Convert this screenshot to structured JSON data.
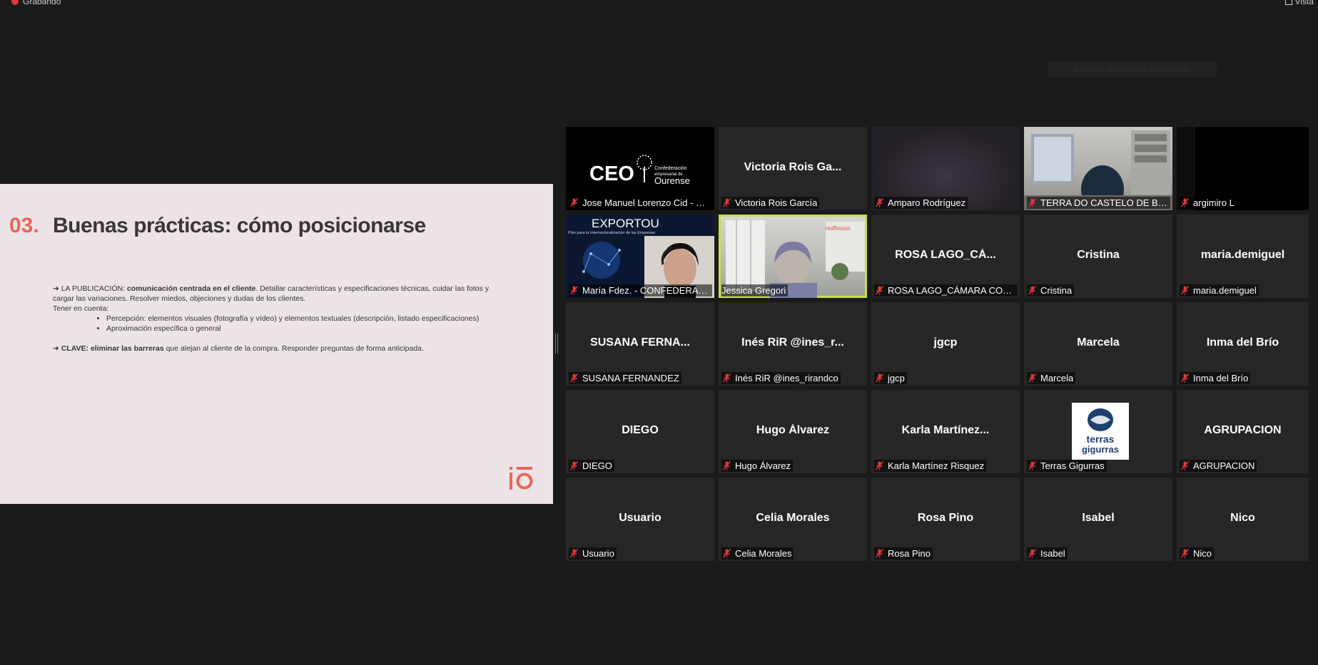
{
  "topbar": {
    "recording_label": "Grabando",
    "view_label": "Vista"
  },
  "banner": {
    "text": "Detener la pantalla compartida"
  },
  "slide": {
    "number": "03.",
    "title": "Buenas prácticas: cómo posicionarse",
    "p1_prefix": "➜ LA PUBLICACIÓN: ",
    "p1_bold": "comunicación centrada en el cliente",
    "p1_rest": ". Detallar características y especificaciones técnicas, cuidar las fotos y cargar las variaciones. Resolver miedos, objeciones y dudas de los clientes.",
    "p2": "Tener en cuenta:",
    "bullets": [
      "Percepción: elementos visuales (fotografía y vídeo) y elementos textuales (descripción, listado especificaciones)",
      "Aproximación específica o general"
    ],
    "p3_prefix": "➜ ",
    "p3_bold": "CLAVE: eliminar las barreras",
    "p3_rest": " que alejan al cliente de la compra. Responder preguntas de forma anticipada.",
    "logo_text": "io"
  },
  "accent_colors": {
    "slide_accent": "#e8655a",
    "active_speaker": "#c7e046",
    "mic_muted": "#e0393e"
  },
  "participants": [
    {
      "label": "Jose Manuel Lorenzo Cid - C...",
      "display": "",
      "video": "ceo-logo",
      "logo_text": "CEO",
      "logo_sub": "Confederación empresarial de Ourense"
    },
    {
      "label": "Victoria Rois García",
      "display": "Victoria Rois Ga..."
    },
    {
      "label": "Amparo Rodríguez",
      "display": "",
      "video": "dark-room"
    },
    {
      "label": "TERRA DO CASTELO DE BEADE",
      "display": "",
      "video": "office"
    },
    {
      "label": "argimiro L",
      "display": "",
      "video": "black"
    },
    {
      "label": "María Fdez. - CONFEDERACI...",
      "display": "",
      "video": "exportou",
      "logo_text": "EXPORTOU",
      "logo_sub": "Plan para la Internacionalización de las Empresas"
    },
    {
      "label": "Jessica Gregori",
      "display": "",
      "video": "person",
      "active": true,
      "logo_text": "redflexión"
    },
    {
      "label": "ROSA LAGO_CÁMARA COME...",
      "display": "ROSA LAGO_CÁ..."
    },
    {
      "label": "Cristina",
      "display": "Cristina"
    },
    {
      "label": "maria.demiguel",
      "display": "maria.demiguel"
    },
    {
      "label": "SUSANA FERNANDEZ",
      "display": "SUSANA FERNA..."
    },
    {
      "label": "Inés RiR @ines_rirandco",
      "display": "Inés RiR @ines_r..."
    },
    {
      "label": "jgcp",
      "display": "jgcp"
    },
    {
      "label": "Marcela",
      "display": "Marcela"
    },
    {
      "label": "Inma del Brío",
      "display": "Inma del Brío"
    },
    {
      "label": "DIEGO",
      "display": "DIEGO"
    },
    {
      "label": "Hugo Álvarez",
      "display": "Hugo Álvarez"
    },
    {
      "label": "Karla Martínez Risquez",
      "display": "Karla Martínez..."
    },
    {
      "label": "Terras Gigurras",
      "display": "",
      "video": "terras-logo",
      "logo_text": "terras gigurras"
    },
    {
      "label": "AGRUPACION",
      "display": "AGRUPACION"
    },
    {
      "label": "Usuario",
      "display": "Usuario"
    },
    {
      "label": "Celia Morales",
      "display": "Celia Morales"
    },
    {
      "label": "Rosa Pino",
      "display": "Rosa Pino"
    },
    {
      "label": "Isabel",
      "display": "Isabel"
    },
    {
      "label": "Nico",
      "display": "Nico"
    }
  ]
}
